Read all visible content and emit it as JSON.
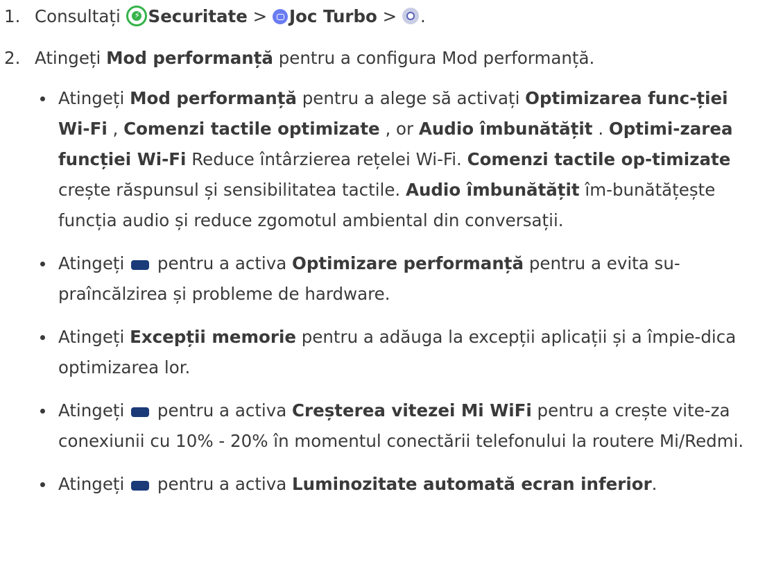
{
  "step1": {
    "number": "1.",
    "text": "Consultați ",
    "security_label": "Securitate",
    "sep1": " > ",
    "turbo_label": "Joc Turbo",
    "sep2": " > ",
    "end": ".",
    "icons": [
      "security-shield-icon",
      "game-turbo-icon",
      "settings-gear-icon"
    ],
    "colors": {
      "security": "#35b34a",
      "turbo": "#6b7cf2",
      "gear": "#c9cde6"
    }
  },
  "step2": {
    "number": "2.",
    "t1": "Atingeți ",
    "b1": "Mod performanță",
    "t2": " pentru a configura Mod performanță."
  },
  "bullets": {
    "b1": {
      "t1": "Atingeți ",
      "s1": "Mod performanță",
      "t2": " pentru a alege să activați ",
      "s2": "Optimizarea func-ției Wi-Fi",
      "t3": " , ",
      "s3": "Comenzi tactile optimizate",
      "t4": " , or ",
      "s4": "Audio îmbunătățit",
      "t5": " . ",
      "s5": "Optimi-zarea funcției Wi-Fi",
      "t6": " Reduce întârzierea rețelei Wi-Fi. ",
      "s6": "Comenzi tactile op-timizate",
      "t7": " crește răspunsul și sensibilitatea tactile. ",
      "s7": "Audio îmbunătățit",
      "t8": " îm-bunătățește funcția audio și reduce zgomotul ambiental din conversații."
    },
    "b2": {
      "t1": "Atingeți ",
      "t2": " pentru a activa ",
      "s1": "Optimizare performanță",
      "t3": " pentru a evita su-praîncălzirea și probleme de hardware."
    },
    "b3": {
      "t1": "Atingeți ",
      "s1": "Excepții memorie",
      "t2": " pentru a adăuga la excepții aplicații și a împie-dica optimizarea lor."
    },
    "b4": {
      "t1": "Atingeți ",
      "t2": " pentru a activa ",
      "s1": "Creșterea vitezei Mi WiFi",
      "t3": " pentru a crește vite-za conexiunii cu 10% - 20% în momentul conectării telefonului la routere Mi/Redmi."
    },
    "b5": {
      "t1": "Atingeți ",
      "t2": " pentru a activa ",
      "s1": "Luminozitate automată ecran inferior",
      "t3": "."
    }
  },
  "toggle_color": "#1a3a78"
}
